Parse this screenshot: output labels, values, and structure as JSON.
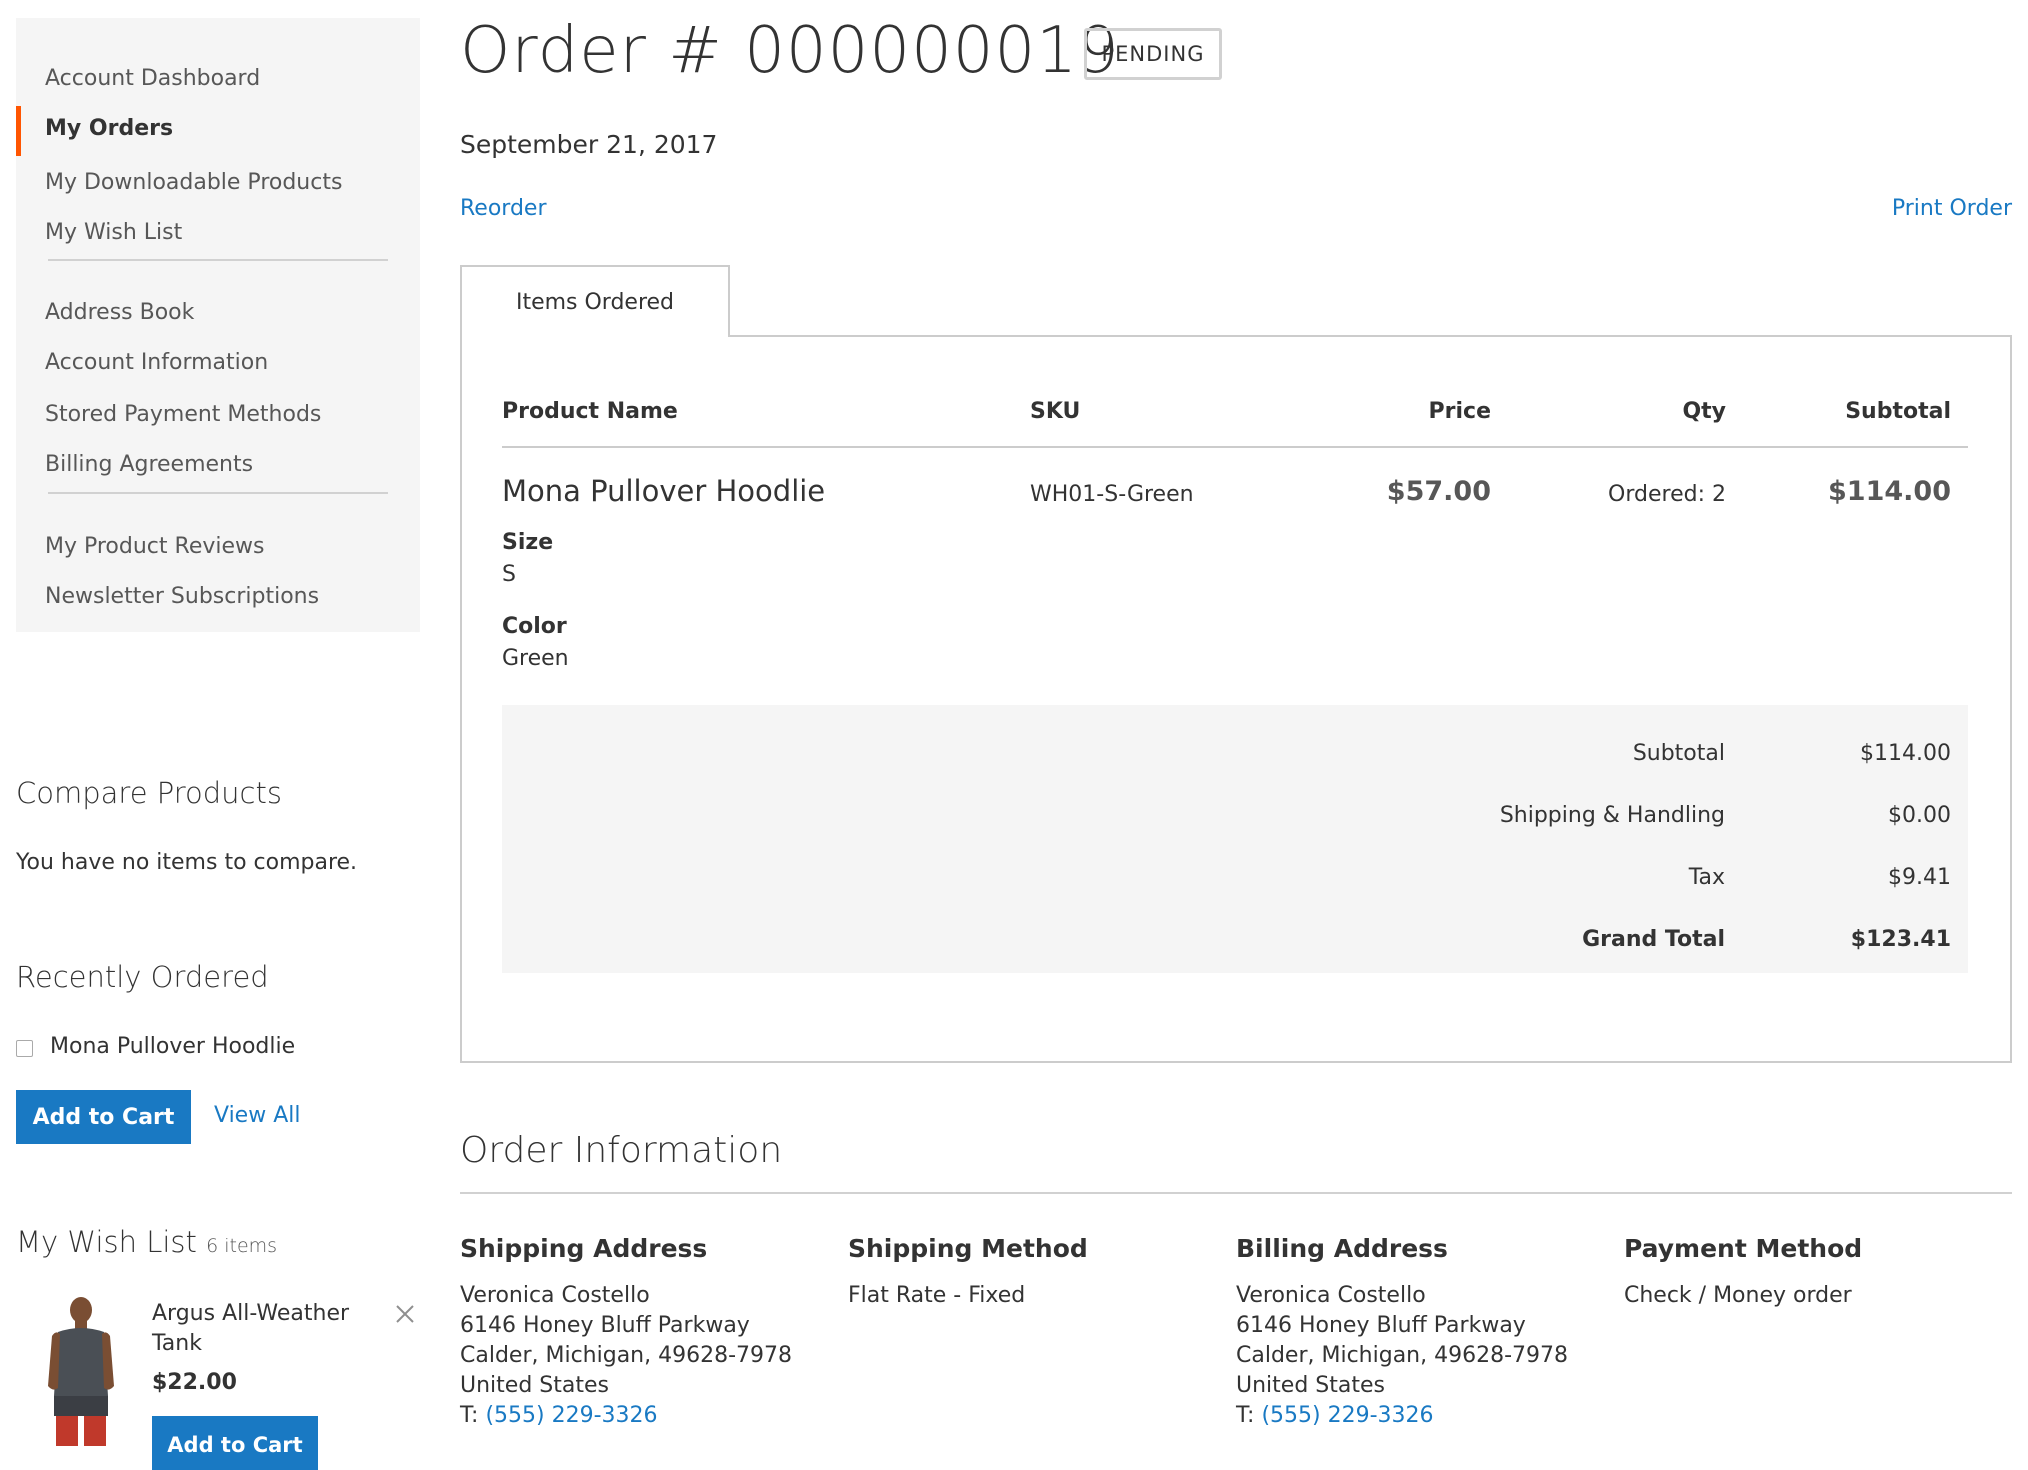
{
  "sidebar": {
    "nav": [
      {
        "label": "Account Dashboard"
      },
      {
        "label": "My Orders"
      },
      {
        "label": "My Downloadable Products"
      },
      {
        "label": "My Wish List"
      },
      {
        "label": "Address Book"
      },
      {
        "label": "Account Information"
      },
      {
        "label": "Stored Payment Methods"
      },
      {
        "label": "Billing Agreements"
      },
      {
        "label": "My Product Reviews"
      },
      {
        "label": "Newsletter Subscriptions"
      }
    ],
    "compare": {
      "title": "Compare Products",
      "empty_text": "You have no items to compare."
    },
    "recently_ordered": {
      "title": "Recently Ordered",
      "item": "Mona Pullover Hoodlie",
      "add_label": "Add to Cart",
      "view_all_label": "View All"
    },
    "wishlist": {
      "title": "My Wish List",
      "count": "6 items",
      "item_name": "Argus All-Weather Tank",
      "item_price": "$22.00",
      "add_label": "Add to Cart"
    }
  },
  "order": {
    "title": "Order # 000000019",
    "status": "PENDING",
    "date": "September 21, 2017",
    "reorder_label": "Reorder",
    "print_label": "Print Order",
    "tab_label": "Items Ordered",
    "columns": {
      "product": "Product Name",
      "sku": "SKU",
      "price": "Price",
      "qty": "Qty",
      "subtotal": "Subtotal"
    },
    "item": {
      "name": "Mona Pullover Hoodlie",
      "options": [
        {
          "label": "Size",
          "value": "S"
        },
        {
          "label": "Color",
          "value": "Green"
        }
      ],
      "sku": "WH01-S-Green",
      "price": "$57.00",
      "qty": "Ordered: 2",
      "subtotal": "$114.00"
    },
    "totals": [
      {
        "label": "Subtotal",
        "value": "$114.00"
      },
      {
        "label": "Shipping & Handling",
        "value": "$0.00"
      },
      {
        "label": "Tax",
        "value": "$9.41"
      },
      {
        "label": "Grand Total",
        "value": "$123.41"
      }
    ]
  },
  "info": {
    "title": "Order Information",
    "shipping_address": {
      "title": "Shipping Address",
      "lines": [
        "Veronica Costello",
        "6146 Honey Bluff Parkway",
        "Calder, Michigan, 49628-7978",
        "United States"
      ],
      "phone_prefix": "T:",
      "phone": "(555) 229-3326"
    },
    "shipping_method": {
      "title": "Shipping Method",
      "value": "Flat Rate - Fixed"
    },
    "billing_address": {
      "title": "Billing Address",
      "lines": [
        "Veronica Costello",
        "6146 Honey Bluff Parkway",
        "Calder, Michigan, 49628-7978",
        "United States"
      ],
      "phone_prefix": "T:",
      "phone": "(555) 229-3326"
    },
    "payment_method": {
      "title": "Payment Method",
      "value": "Check / Money order"
    }
  },
  "colors": {
    "accent": "#1979c3",
    "nav_current": "#ff5501",
    "panel_bg": "#f5f5f5",
    "border": "#cccccc"
  },
  "icons": {
    "remove": "close-icon",
    "product_thumb": "product-image"
  }
}
